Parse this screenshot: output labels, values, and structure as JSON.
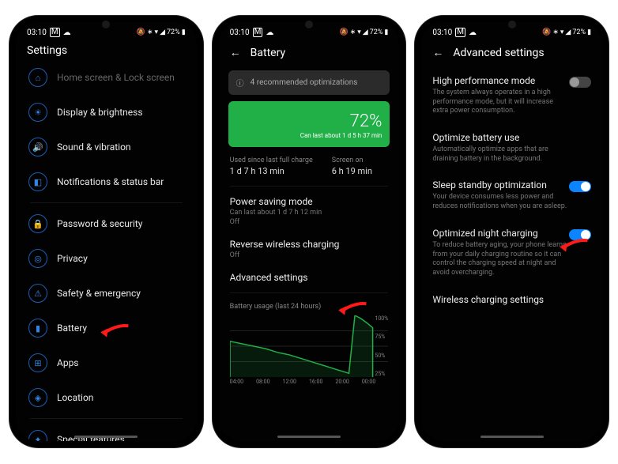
{
  "status": {
    "time": "03:10",
    "battery": "72%"
  },
  "phone1": {
    "title": "Settings",
    "items": [
      {
        "icon": "⌂",
        "label": "Home screen & Lock screen",
        "dim": true
      },
      {
        "icon": "☀",
        "label": "Display & brightness"
      },
      {
        "icon": "🔊",
        "label": "Sound & vibration"
      },
      {
        "icon": "◧",
        "label": "Notifications & status bar"
      },
      {
        "type": "gap"
      },
      {
        "icon": "🔒",
        "label": "Password & security"
      },
      {
        "icon": "◎",
        "label": "Privacy"
      },
      {
        "icon": "⚠",
        "label": "Safety & emergency"
      },
      {
        "icon": "▮",
        "label": "Battery"
      },
      {
        "icon": "⊞",
        "label": "Apps"
      },
      {
        "icon": "◈",
        "label": "Location"
      },
      {
        "type": "gap"
      },
      {
        "icon": "✦",
        "label": "Special features"
      }
    ]
  },
  "phone2": {
    "title": "Battery",
    "banner": "4 recommended optimizations",
    "pct": "72%",
    "last": "Can last about 1 d 5 h 37 min",
    "stat1_label": "Used since last full charge",
    "stat1_val": "1 d 7 h 13 min",
    "stat2_label": "Screen on",
    "stat2_val": "6 h 19 min",
    "rows": [
      {
        "t": "Power saving mode",
        "s": "Can last about 1 d 7 h 12 min",
        "s2": "Off"
      },
      {
        "t": "Reverse wireless charging",
        "s": "Off"
      },
      {
        "t": "Advanced settings"
      }
    ],
    "chart": {
      "title": "Battery usage (last 24 hours)",
      "y": [
        "100%",
        "75%",
        "50%",
        "25%"
      ],
      "x": [
        "04:00",
        "08:00",
        "12:00",
        "16:00",
        "20:00",
        "00:00"
      ]
    }
  },
  "phone3": {
    "title": "Advanced settings",
    "rows": [
      {
        "t": "High performance mode",
        "s": "The system always operates in a high performance mode, but it will increase extra power consumption.",
        "on": false
      },
      {
        "t": "Optimize battery use",
        "s": "Automatically optimize apps that are draining battery in the background."
      },
      {
        "t": "Sleep standby optimization",
        "s": "Your device consumes less power and reduces notifications when you are asleep.",
        "on": true
      },
      {
        "t": "Optimized night charging",
        "s": "To reduce battery aging, your phone learns from your daily charging routine so it can control the charging speed at night and avoid overcharging.",
        "on": true
      },
      {
        "t": "Wireless charging settings"
      }
    ]
  },
  "chart_data": {
    "type": "line",
    "title": "Battery usage (last 24 hours)",
    "xlabel": "",
    "ylabel": "",
    "ylim": [
      0,
      100
    ],
    "x_hours": [
      3,
      4,
      5,
      6,
      7,
      8,
      9,
      10,
      11,
      12,
      13,
      14,
      15,
      16,
      17,
      18,
      19,
      20,
      21,
      22,
      23,
      24,
      25,
      26,
      27
    ],
    "values": [
      58,
      56,
      54,
      52,
      50,
      48,
      46,
      43,
      40,
      38,
      36,
      33,
      30,
      27,
      24,
      21,
      18,
      15,
      12,
      9,
      6,
      100,
      95,
      88,
      80
    ],
    "x_tick_labels": [
      "04:00",
      "08:00",
      "12:00",
      "16:00",
      "20:00",
      "00:00"
    ]
  }
}
